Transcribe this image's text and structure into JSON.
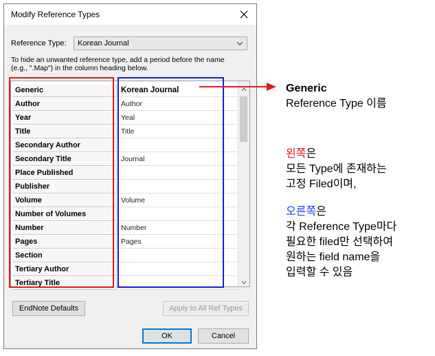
{
  "dialog": {
    "title": "Modify Reference Types",
    "reference_type_label": "Reference Type:",
    "reference_type_value": "Korean Journal",
    "hint_line1": "To hide an unwanted reference type, add a period before the name",
    "hint_line2": "(e.g., \".Map\") in the column heading below.",
    "rows": [
      {
        "generic": "Generic",
        "type": "Korean Journal"
      },
      {
        "generic": "Author",
        "type": "Author"
      },
      {
        "generic": "Year",
        "type": "Yeal"
      },
      {
        "generic": "Title",
        "type": "Title"
      },
      {
        "generic": "Secondary Author",
        "type": ""
      },
      {
        "generic": "Secondary Title",
        "type": "Journal"
      },
      {
        "generic": "Place Published",
        "type": ""
      },
      {
        "generic": "Publisher",
        "type": ""
      },
      {
        "generic": "Volume",
        "type": "Volume"
      },
      {
        "generic": "Number of Volumes",
        "type": ""
      },
      {
        "generic": "Number",
        "type": "Number"
      },
      {
        "generic": "Pages",
        "type": "Pages"
      },
      {
        "generic": "Section",
        "type": ""
      },
      {
        "generic": "Tertiary Author",
        "type": ""
      },
      {
        "generic": "Tertiary Title",
        "type": ""
      }
    ],
    "buttons": {
      "defaults": "EndNote Defaults",
      "apply_all": "Apply to All Ref Types",
      "ok": "OK",
      "cancel": "Cancel"
    }
  },
  "annotations": {
    "generic_title": "Generic",
    "generic_desc": "Reference Type 이름",
    "left_word": "왼쪽",
    "left_suffix": "은",
    "left_line2": "모든 Type에 존재하는",
    "left_line3": "고정 Filed이며,",
    "right_word": "오른쪽",
    "right_suffix": "은",
    "right_line2": "각 Reference Type마다",
    "right_line3": "필요한 filed만 선택하여",
    "right_line4": "원하는 field name을",
    "right_line5": "입력할 수 있음"
  },
  "colors": {
    "left_highlight": "#e01a1a",
    "right_highlight": "#1a1ae0"
  },
  "icons": [
    "close-icon",
    "chevron-down-icon",
    "scroll-up-icon",
    "scroll-down-icon",
    "arrow-right-icon"
  ]
}
